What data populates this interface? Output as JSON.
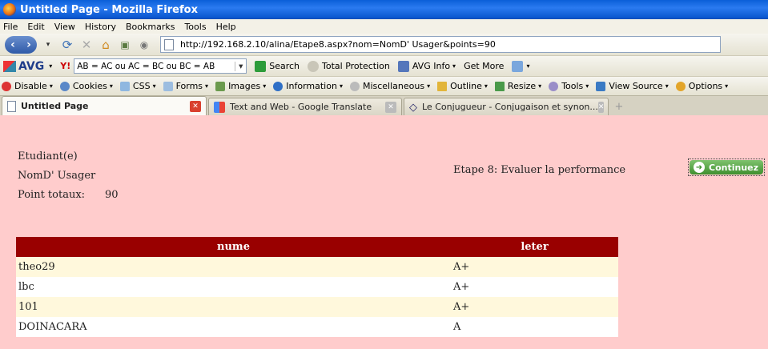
{
  "window": {
    "title": "Untitled Page - Mozilla Firefox"
  },
  "menu": [
    "File",
    "Edit",
    "View",
    "History",
    "Bookmarks",
    "Tools",
    "Help"
  ],
  "nav": {
    "url": "http://192.168.2.10/alina/Etape8.aspx?nom=NomD' Usager&points=90"
  },
  "avg_toolbar": {
    "brand": "AVG",
    "search_value": "AB = AC ou AC = BC ou BC = AB",
    "search_label": "Search",
    "protection_label": "Total Protection",
    "info_label": "AVG Info",
    "more_label": "Get More"
  },
  "webdev_toolbar": {
    "items": [
      "Disable",
      "Cookies",
      "CSS",
      "Forms",
      "Images",
      "Information",
      "Miscellaneous",
      "Outline",
      "Resize",
      "Tools",
      "View Source",
      "Options"
    ]
  },
  "tabs": [
    {
      "label": "Untitled Page"
    },
    {
      "label": "Text and Web - Google Translate"
    },
    {
      "label": "Le Conjugueur - Conjugaison et synon..."
    }
  ],
  "page": {
    "student_label": "Etudiant(e)",
    "username": "NomD' Usager",
    "points_label": "Point totaux:",
    "points_value": "90",
    "stage_title": "Etape 8: Evaluer la performance",
    "continue_label": "Continuez",
    "table": {
      "headers": [
        "nume",
        "leter"
      ],
      "rows": [
        [
          "theo29",
          "A+"
        ],
        [
          "lbc",
          "A+"
        ],
        [
          "101",
          "A+"
        ],
        [
          "DOINACARA",
          "A"
        ]
      ]
    }
  },
  "colors": {
    "header_red": "#990000",
    "page_bg": "#ffcccc",
    "row_odd": "#fff8dc",
    "button_green": "#3f8f2f"
  }
}
